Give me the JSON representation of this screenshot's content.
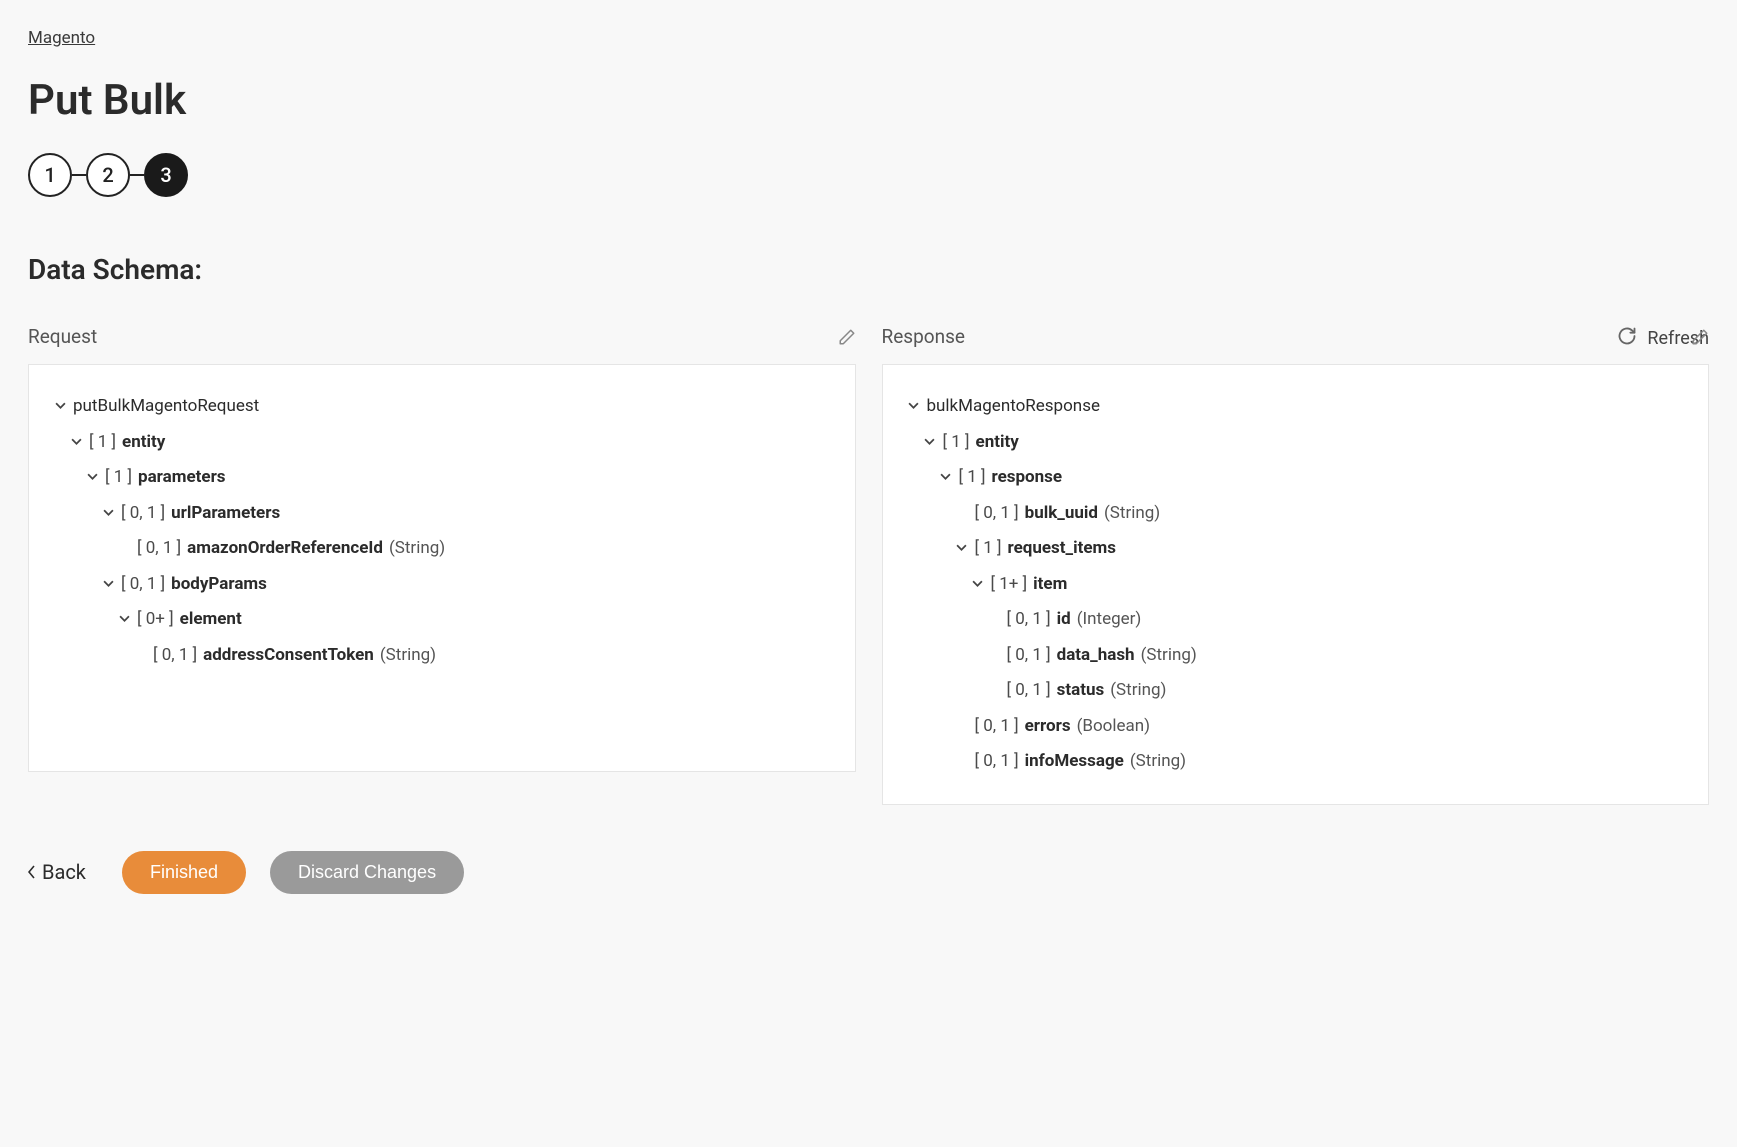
{
  "breadcrumb": "Magento",
  "page_title": "Put Bulk",
  "stepper": {
    "steps": [
      "1",
      "2",
      "3"
    ],
    "active_index": 2
  },
  "section_title": "Data Schema:",
  "refresh_label": "Refresh",
  "columns": {
    "request": {
      "label": "Request"
    },
    "response": {
      "label": "Response"
    }
  },
  "request_tree": {
    "root": "putBulkMagentoRequest",
    "entity": {
      "card": "[ 1 ]",
      "name": "entity"
    },
    "parameters": {
      "card": "[ 1 ]",
      "name": "parameters"
    },
    "urlParameters": {
      "card": "[ 0, 1 ]",
      "name": "urlParameters"
    },
    "amazonOrderReferenceId": {
      "card": "[ 0, 1 ]",
      "name": "amazonOrderReferenceId",
      "type": "(String)"
    },
    "bodyParams": {
      "card": "[ 0, 1 ]",
      "name": "bodyParams"
    },
    "element": {
      "card": "[ 0+ ]",
      "name": "element"
    },
    "addressConsentToken": {
      "card": "[ 0, 1 ]",
      "name": "addressConsentToken",
      "type": "(String)"
    }
  },
  "response_tree": {
    "root": "bulkMagentoResponse",
    "entity": {
      "card": "[ 1 ]",
      "name": "entity"
    },
    "response": {
      "card": "[ 1 ]",
      "name": "response"
    },
    "bulk_uuid": {
      "card": "[ 0, 1 ]",
      "name": "bulk_uuid",
      "type": "(String)"
    },
    "request_items": {
      "card": "[ 1 ]",
      "name": "request_items"
    },
    "item": {
      "card": "[ 1+ ]",
      "name": "item"
    },
    "id": {
      "card": "[ 0, 1 ]",
      "name": "id",
      "type": "(Integer)"
    },
    "data_hash": {
      "card": "[ 0, 1 ]",
      "name": "data_hash",
      "type": "(String)"
    },
    "status": {
      "card": "[ 0, 1 ]",
      "name": "status",
      "type": "(String)"
    },
    "errors": {
      "card": "[ 0, 1 ]",
      "name": "errors",
      "type": "(Boolean)"
    },
    "infoMessage": {
      "card": "[ 0, 1 ]",
      "name": "infoMessage",
      "type": "(String)"
    }
  },
  "actions": {
    "back": "Back",
    "finished": "Finished",
    "discard": "Discard Changes"
  }
}
